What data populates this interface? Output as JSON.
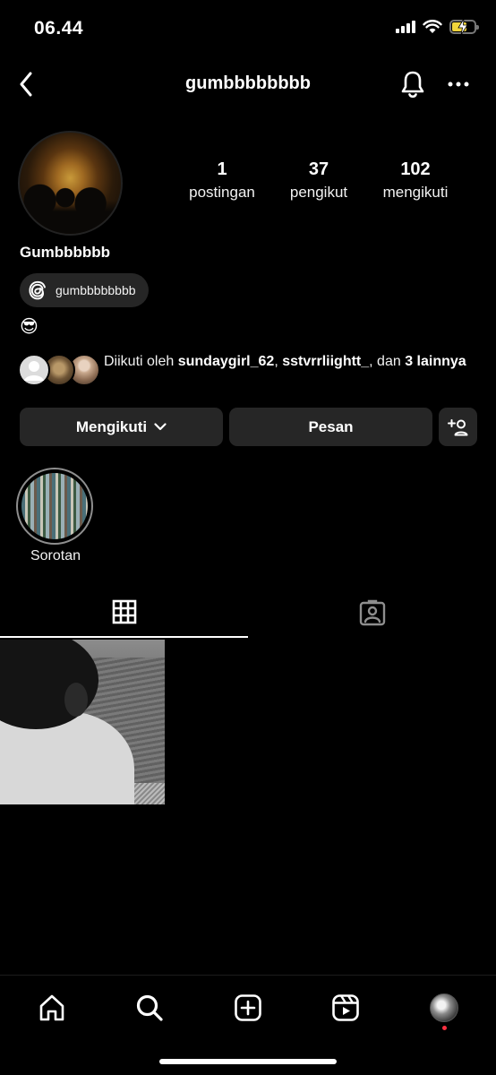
{
  "status_bar": {
    "time": "06.44",
    "battery_state": "charging",
    "battery_color": "#f2d53c"
  },
  "nav": {
    "username": "gumbbbbbbbb",
    "back_icon": "chevron-left-icon",
    "notifications_icon": "bell-icon",
    "more_icon": "more-horizontal-icon"
  },
  "profile": {
    "stats": [
      {
        "value": "1",
        "label": "postingan"
      },
      {
        "value": "37",
        "label": "pengikut"
      },
      {
        "value": "102",
        "label": "mengikuti"
      }
    ],
    "display_name": "Gumbbbbbb",
    "threads_handle": "gumbbbbbbbb",
    "bio": "😎",
    "followed_by": {
      "prefix": "Diikuti oleh",
      "user1": "sundaygirl_62",
      "separator": ",",
      "user2": "sstvrrliightt_",
      "conjunction": ", dan",
      "others": "3 lainnya"
    }
  },
  "actions": {
    "following_label": "Mengikuti",
    "message_label": "Pesan",
    "add_person_icon": "add-person-icon"
  },
  "highlights": [
    {
      "label": "Sorotan"
    }
  ],
  "tabs": [
    {
      "name": "posts",
      "icon": "grid-icon",
      "active": true
    },
    {
      "name": "tagged",
      "icon": "tagged-person-icon",
      "active": false
    }
  ],
  "posts": [
    {
      "description_icon": "photo-thumbnail"
    }
  ],
  "bottom_nav": [
    {
      "name": "home",
      "icon": "home-icon"
    },
    {
      "name": "search",
      "icon": "search-icon"
    },
    {
      "name": "create",
      "icon": "plus-square-icon"
    },
    {
      "name": "reels",
      "icon": "reels-icon"
    },
    {
      "name": "profile",
      "icon": "profile-avatar"
    }
  ],
  "colors": {
    "background": "#000000",
    "button": "#262626",
    "notification_dot": "#ff3040"
  }
}
